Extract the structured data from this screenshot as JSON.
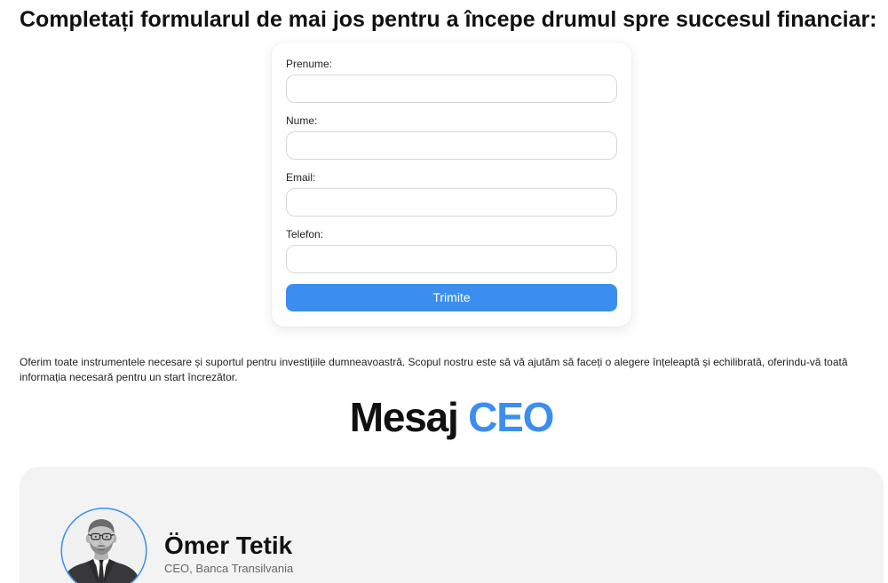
{
  "page": {
    "heading": "Completați formularul de mai jos pentru a începe drumul spre succesul financiar:"
  },
  "form": {
    "fields": [
      {
        "label": "Prenume:",
        "value": ""
      },
      {
        "label": "Nume:",
        "value": ""
      },
      {
        "label": "Email:",
        "value": ""
      },
      {
        "label": "Telefon:",
        "value": ""
      }
    ],
    "submit_label": "Trimite"
  },
  "intro": {
    "text": "Oferim toate instrumentele necesare și suportul pentru investițiile dumneavoastră. Scopul nostru este să vă ajutăm să faceți o alegere înțeleaptă și echilibrată, oferindu-vă toată informația necesară pentru un start încrezător."
  },
  "ceo_section": {
    "title_main": "Mesaj",
    "title_accent": "CEO",
    "name": "Ömer Tetik",
    "role": "CEO, Banca Transilvania",
    "avatar_icon": "ceo-portrait-photo"
  },
  "colors": {
    "accent": "#3b8ef0",
    "text": "#111111",
    "muted_text": "#666666",
    "card_background": "#f3f3f3",
    "input_border": "#d8d8d8"
  }
}
